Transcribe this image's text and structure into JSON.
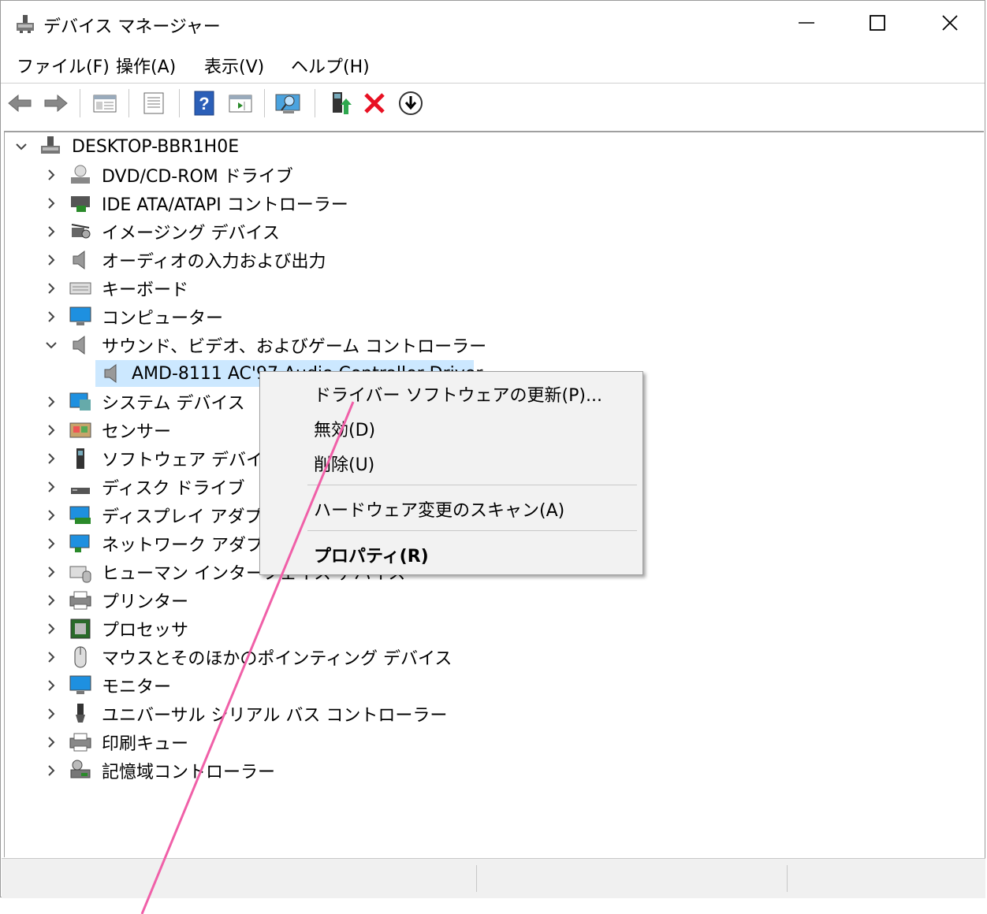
{
  "window": {
    "title": "デバイス マネージャー"
  },
  "menu": [
    "ファイル(F)",
    "操作(A)",
    "表示(V)",
    "ヘルプ(H)"
  ],
  "toolbar": {
    "icons": [
      "back-arrow-icon",
      "forward-arrow-icon",
      "show-hide-tree-icon",
      "properties-icon",
      "help-icon",
      "action-pane-icon",
      "scan-hardware-icon",
      "update-driver-icon",
      "uninstall-icon",
      "download-icon"
    ]
  },
  "tree": {
    "root": "DESKTOP-BBR1H0E",
    "categories": [
      "DVD/CD-ROM ドライブ",
      "IDE ATA/ATAPI コントローラー",
      "イメージング デバイス",
      "オーディオの入力および出力",
      "キーボード",
      "コンピューター",
      "サウンド、ビデオ、およびゲーム コントローラー",
      "システム デバイス",
      "センサー",
      "ソフトウェア デバイス",
      "ディスク ドライブ",
      "ディスプレイ アダプター",
      "ネットワーク アダプター",
      "ヒューマン インターフェイス デバイス",
      "プリンター",
      "プロセッサ",
      "マウスとそのほかのポインティング デバイス",
      "モニター",
      "ユニバーサル シリアル バス コントローラー",
      "印刷キュー",
      "記憶域コントローラー"
    ],
    "selected_device": "AMD-8111 AC'97 Audio Controller Driver"
  },
  "context_menu": {
    "items": [
      "ドライバー ソフトウェアの更新(P)...",
      "無効(D)",
      "削除(U)",
      "ハードウェア変更のスキャン(A)",
      "プロパティ(R)"
    ]
  },
  "colors": {
    "selection": "#cce8ff",
    "annotation_line": "#f060a8",
    "delete_red": "#e81123"
  }
}
